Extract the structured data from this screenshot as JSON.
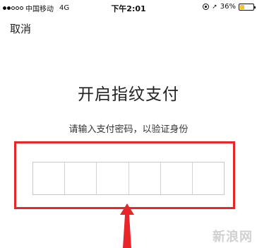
{
  "status_bar": {
    "carrier": "中国移动",
    "network": "4G",
    "time": "下午2:01",
    "battery_percent_text": "36%",
    "battery_level": 0.36,
    "battery_color": "#f5c518"
  },
  "nav": {
    "cancel_label": "取消"
  },
  "main": {
    "title": "开启指纹支付",
    "subtitle": "请输入支付密码，以验证身份",
    "password_length": 6
  },
  "annotation": {
    "color": "#e8262a"
  },
  "watermark": "新浪网"
}
